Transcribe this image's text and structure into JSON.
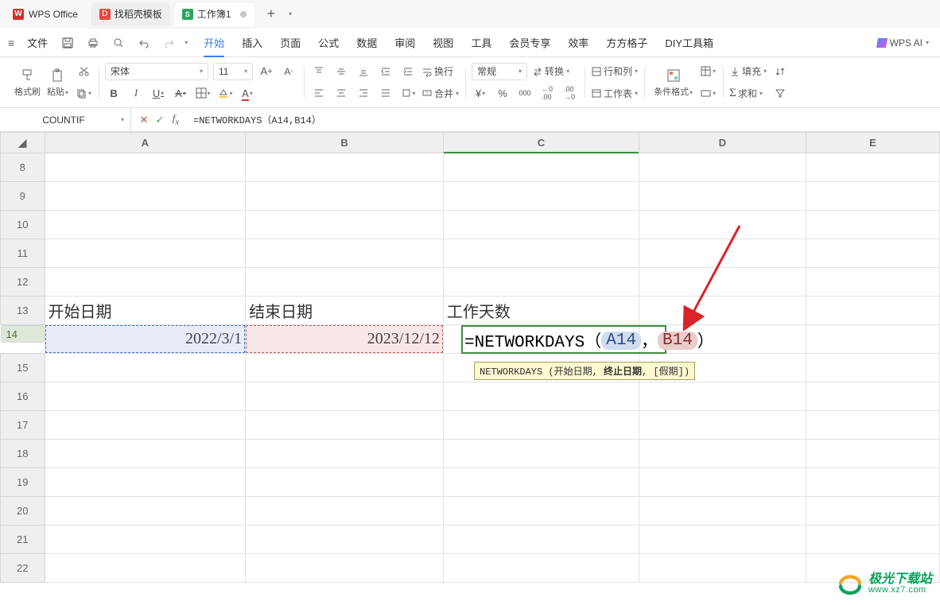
{
  "titlebar": {
    "app_name": "WPS Office",
    "template_tab": "找稻壳模板",
    "doc_tab": "工作簿1",
    "s_icon": "S",
    "plus": "+",
    "more": "⋯"
  },
  "menubar": {
    "file": "文件",
    "items": [
      "开始",
      "插入",
      "页面",
      "公式",
      "数据",
      "审阅",
      "视图",
      "工具",
      "会员专享",
      "效率",
      "方方格子",
      "DIY工具箱"
    ],
    "ai": "WPS AI",
    "ai_caret": "▾"
  },
  "ribbon": {
    "format_painter": "格式刷",
    "paste": "粘贴",
    "font_name": "宋体",
    "font_size": "11",
    "wrap": "换行",
    "merge": "合并",
    "number_format": "常规",
    "currency": "¥",
    "percent": "%",
    "thousands": "000",
    "dec_inc": ".0←",
    "dec_dec": "←.0",
    "convert": "转换",
    "rowcol": "行和列",
    "worksheet": "工作表",
    "condfmt": "条件格式",
    "fill": "填充",
    "sum": "求和"
  },
  "formulabar": {
    "name": "COUNTIF",
    "formula": "=NETWORKDAYS（A14,B14）"
  },
  "columns": [
    "A",
    "B",
    "C",
    "D",
    "E"
  ],
  "rows": [
    "8",
    "9",
    "10",
    "11",
    "12",
    "13",
    "14",
    "15",
    "16",
    "17",
    "18",
    "19",
    "20",
    "21",
    "22"
  ],
  "cells": {
    "A13": "开始日期",
    "B13": "结束日期",
    "C13": "工作天数",
    "A14": "2022/3/1",
    "B14": "2023/12/12"
  },
  "formula_cell": {
    "prefix": "=NETWORKDAYS（",
    "ref1": "A14",
    "comma": "，",
    "ref2": "B14",
    "suffix": "）"
  },
  "tooltip": {
    "fn": "NETWORKDAYS",
    "sig": " (开始日期, ",
    "bold": "终止日期",
    "rest": ", [假期])"
  },
  "watermark": {
    "line1": "极光下载站",
    "line2": "www.xz7.com"
  }
}
